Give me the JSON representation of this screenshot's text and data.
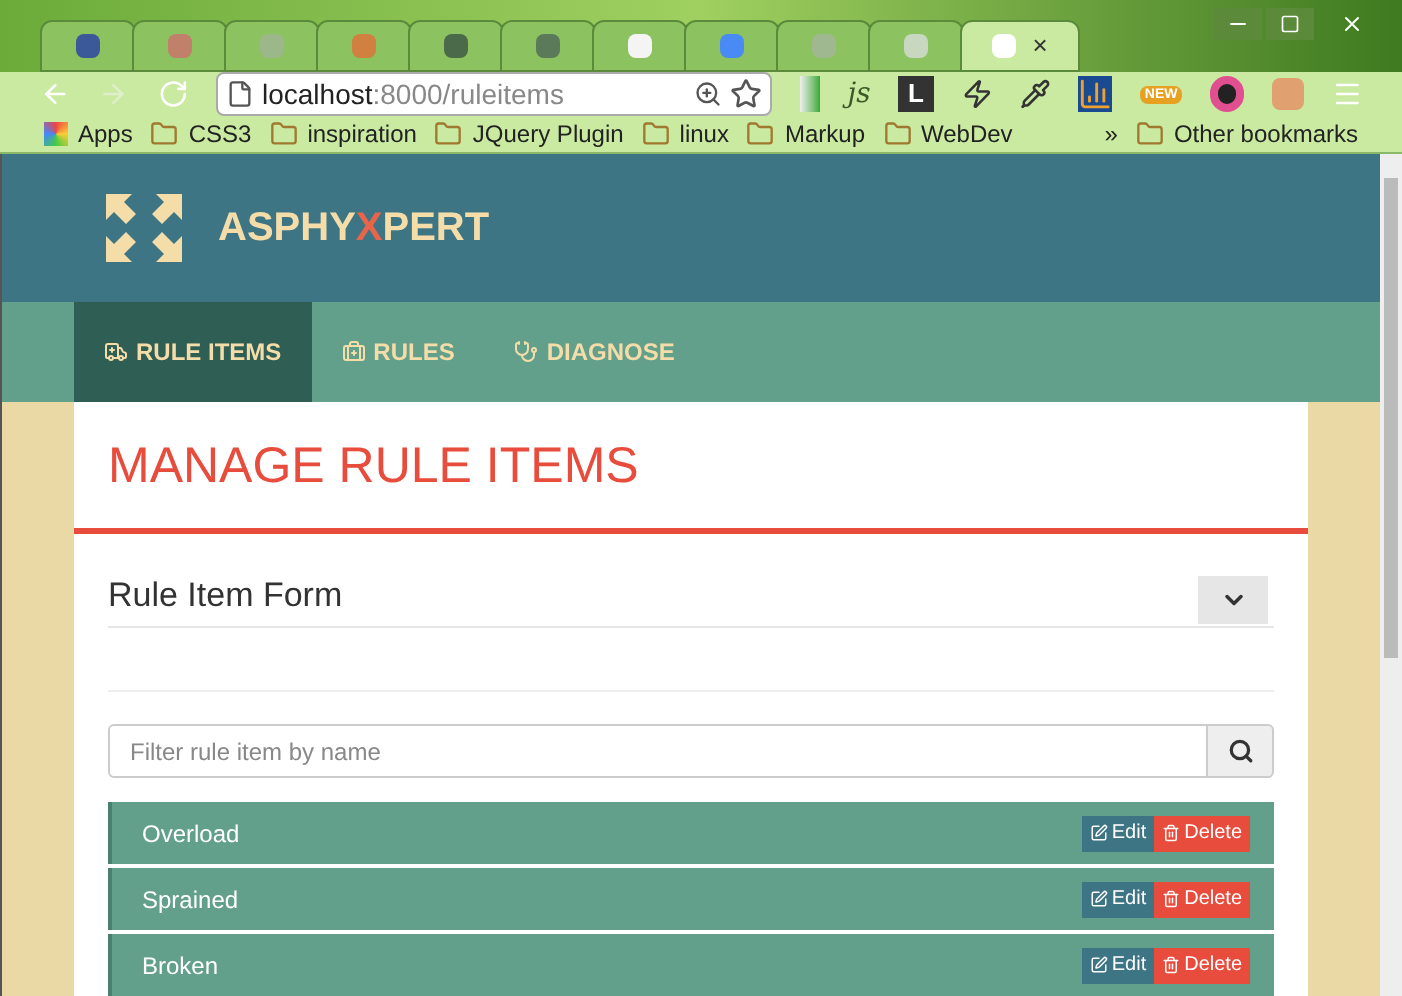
{
  "browser": {
    "tabs": [
      {
        "selected": false,
        "color": "#3b5998"
      },
      {
        "selected": false,
        "color": "#c0806a"
      },
      {
        "selected": false,
        "color": "#9cb88a"
      },
      {
        "selected": false,
        "color": "#d08040"
      },
      {
        "selected": false,
        "color": "#4a6a4a"
      },
      {
        "selected": false,
        "color": "#5a7a5a"
      },
      {
        "selected": false,
        "color": "#f4f4f4"
      },
      {
        "selected": false,
        "color": "#4a8af4"
      },
      {
        "selected": false,
        "color": "#a0b890"
      },
      {
        "selected": false,
        "color": "#c8d8c0"
      },
      {
        "selected": true,
        "color": "#ffffff",
        "close": "×"
      }
    ],
    "address": {
      "host": "localhost",
      "path": ":8000/ruleitems"
    },
    "extensions": [
      {
        "kind": "text",
        "label": "js"
      },
      {
        "kind": "tile",
        "label": "L"
      },
      {
        "kind": "badge",
        "label": "NEW"
      }
    ],
    "bookmarks": {
      "apps": "Apps",
      "folders": [
        "CSS3",
        "inspiration",
        "JQuery Plugin",
        "linux",
        "Markup",
        "WebDev"
      ],
      "more": "»",
      "other": "Other bookmarks"
    }
  },
  "brand": {
    "before": "ASPHY",
    "accent": "X",
    "after": "PERT"
  },
  "nav": [
    {
      "label": "RULE ITEMS",
      "selected": true
    },
    {
      "label": "RULES",
      "selected": false
    },
    {
      "label": "DIAGNOSE",
      "selected": false
    }
  ],
  "title": "MANAGE RULE ITEMS",
  "panel": {
    "title": "Rule Item Form",
    "expanded": false
  },
  "filter": {
    "placeholder": "Filter rule item by name"
  },
  "rows": [
    {
      "name": "Overload",
      "edit": "Edit",
      "delete": "Delete"
    },
    {
      "name": "Sprained",
      "edit": "Edit",
      "delete": "Delete"
    },
    {
      "name": "Broken",
      "edit": "Edit",
      "delete": "Delete"
    }
  ]
}
